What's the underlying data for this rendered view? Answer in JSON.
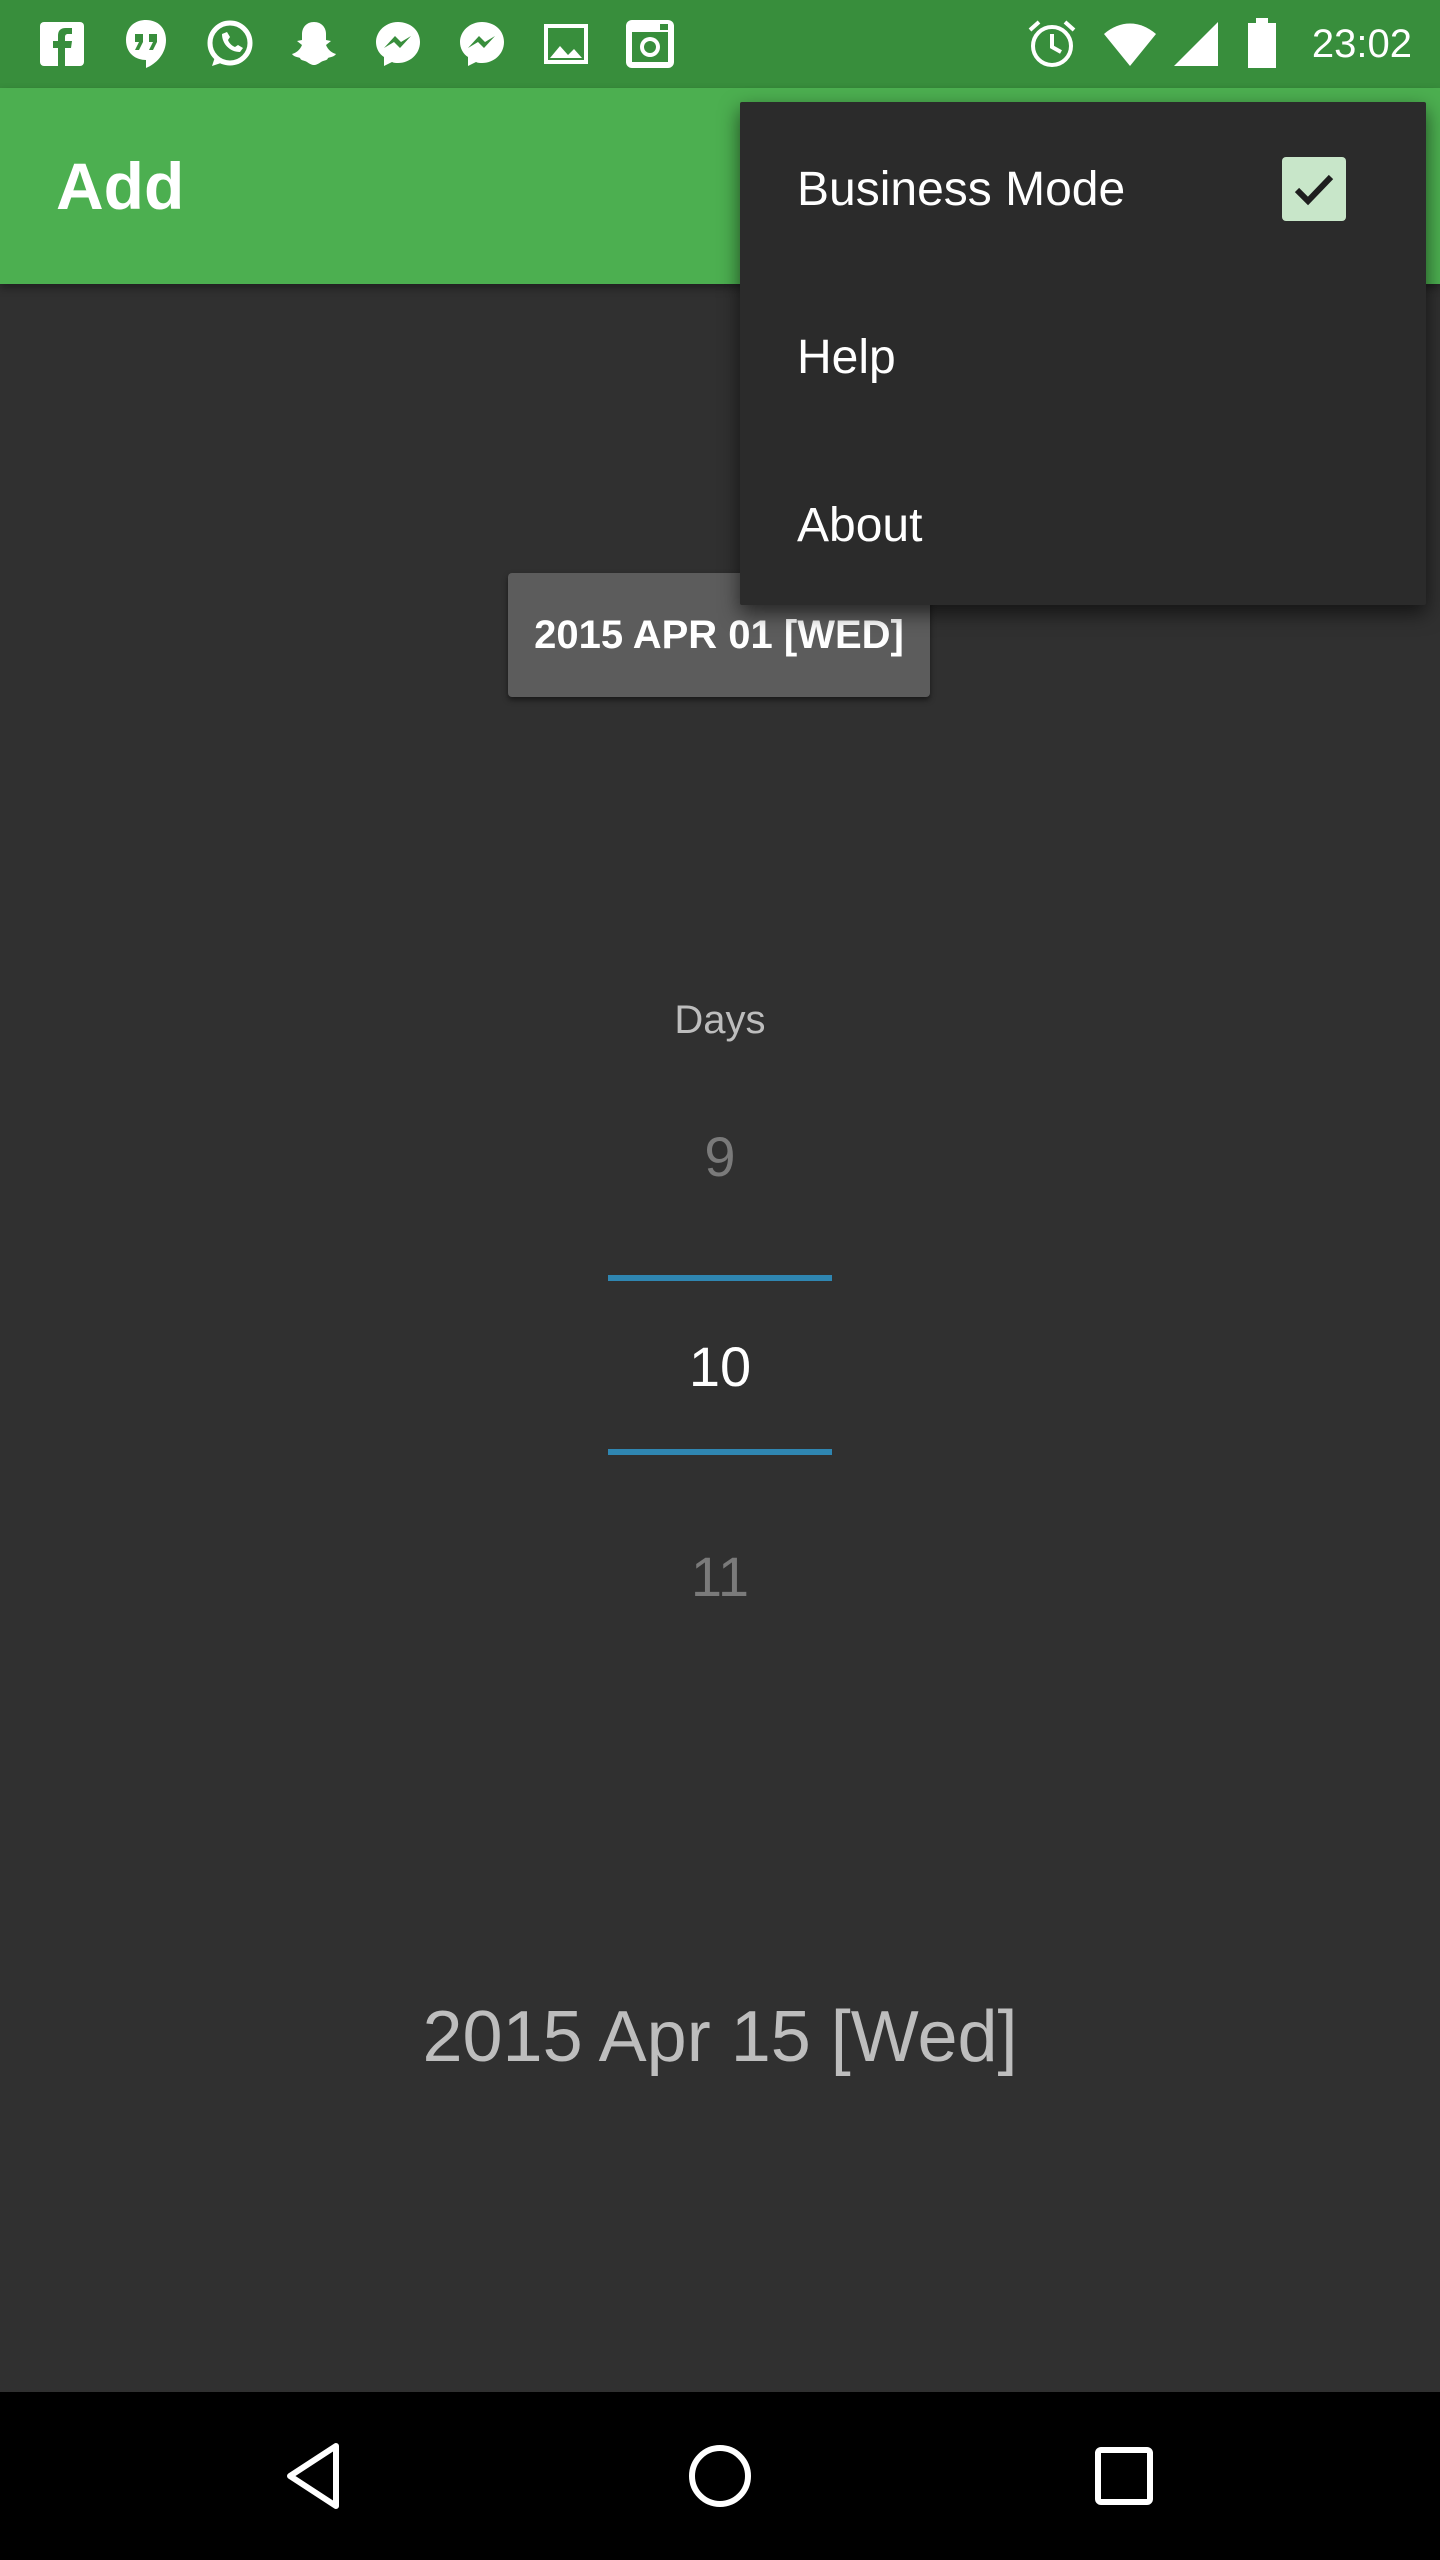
{
  "status_bar": {
    "time": "23:02",
    "notification_icons": [
      "facebook-icon",
      "hangouts-icon",
      "whatsapp-icon",
      "snapchat-icon",
      "messenger-icon",
      "messenger-icon",
      "gallery-icon",
      "instagram-icon"
    ],
    "system_icons": [
      "alarm-icon",
      "wifi-icon",
      "cell-signal-icon",
      "battery-icon"
    ],
    "color": "#388e3c"
  },
  "app_bar": {
    "title": "Add",
    "color": "#4caf50"
  },
  "menu": {
    "items": [
      {
        "label": "Business Mode",
        "checked": true
      },
      {
        "label": "Help"
      },
      {
        "label": "About"
      }
    ]
  },
  "date_button": {
    "label": "2015 APR 01 [WED]"
  },
  "picker": {
    "label": "Days",
    "prev": "9",
    "current": "10",
    "next": "11",
    "accent": "#2f86b1"
  },
  "result": {
    "date": "2015 Apr 15 [Wed]"
  },
  "nav_bar": {
    "icons": [
      "back-icon",
      "home-icon",
      "recents-icon"
    ]
  }
}
